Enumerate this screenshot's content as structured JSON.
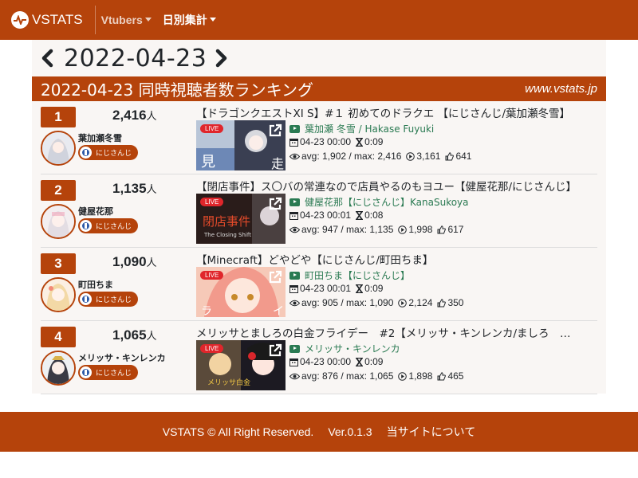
{
  "nav": {
    "brand": "VSTATS",
    "items": [
      {
        "label": "Vtubers"
      },
      {
        "label": "日別集計"
      }
    ]
  },
  "date_nav": {
    "date": "2022-04-23"
  },
  "ranking": {
    "title": "2022-04-23 同時視聴者数ランキング",
    "site": "www.vstats.jp",
    "entries": [
      {
        "rank": "1",
        "viewers": "2,416",
        "unit": "人",
        "name": "葉加瀬冬雪",
        "org": "にじさんじ",
        "title": "【ドラゴンクエストXI S】#１ 初めてのドラクエ 【にじさんじ/葉加瀬冬雪】",
        "live": "LIVE",
        "channel": "葉加瀬 冬雪 / Hakase Fuyuki",
        "time": "04-23 00:00",
        "duration": "0:09",
        "stats": "avg: 1,902 / max: 2,416",
        "plays": "3,161",
        "likes": "641"
      },
      {
        "rank": "2",
        "viewers": "1,135",
        "unit": "人",
        "name": "健屋花那",
        "org": "にじさんじ",
        "title": "【閉店事件】ス〇バの常連なので店員やるのもヨユー【健屋花那/にじさんじ】",
        "live": "LIVE",
        "channel": "健屋花那【にじさんじ】KanaSukoya",
        "time": "04-23 00:01",
        "duration": "0:08",
        "stats": "avg: 947 / max: 1,135",
        "plays": "1,998",
        "likes": "617"
      },
      {
        "rank": "3",
        "viewers": "1,090",
        "unit": "人",
        "name": "町田ちま",
        "org": "にじさんじ",
        "title": "【Minecraft】どやどや【にじさんじ/町田ちま】",
        "live": "LIVE",
        "channel": "町田ちま【にじさんじ】",
        "time": "04-23 00:01",
        "duration": "0:09",
        "stats": "avg: 905 / max: 1,090",
        "plays": "2,124",
        "likes": "350"
      },
      {
        "rank": "4",
        "viewers": "1,065",
        "unit": "人",
        "name": "メリッサ・キンレンカ",
        "org": "にじさんじ",
        "title": "メリッサとましろの白金フライデー　#2【メリッサ・キンレンカ/ましろ　…",
        "live": "LIVE",
        "channel": "メリッサ・キンレンカ",
        "time": "04-23 00:00",
        "duration": "0:09",
        "stats": "avg: 876 / max: 1,065",
        "plays": "1,898",
        "likes": "465"
      }
    ]
  },
  "footer": {
    "copyright": "VSTATS © All Right Reserved.",
    "version": "Ver.0.1.3",
    "about": "当サイトについて"
  },
  "colors": {
    "brand": "#b5430b",
    "channel": "#2a7a52",
    "live": "#e0262b",
    "panel": "#f9f6f4"
  }
}
